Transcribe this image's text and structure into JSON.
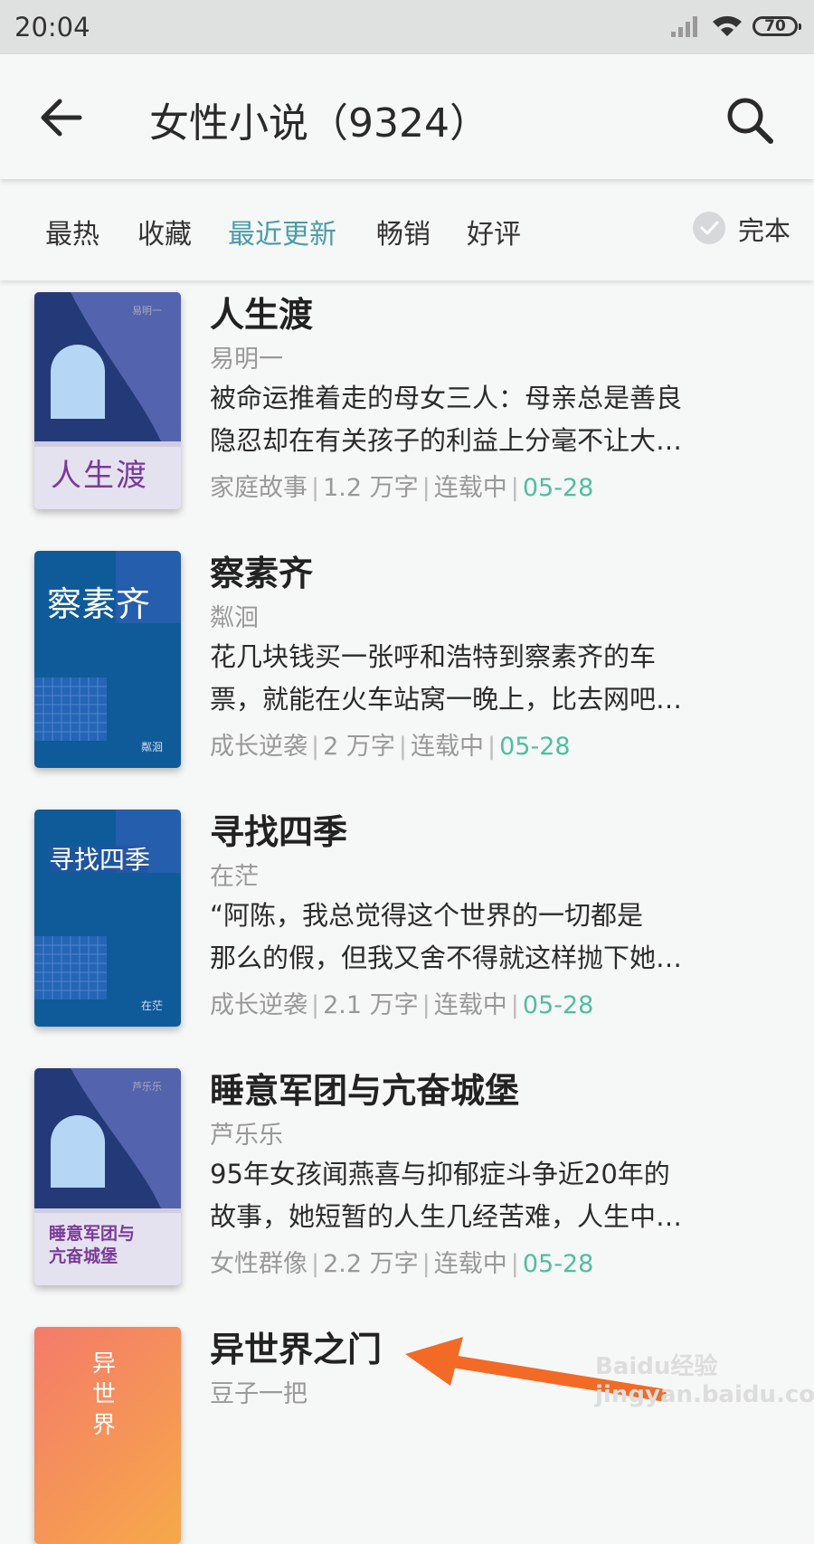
{
  "status": {
    "time": "20:04",
    "battery": "70"
  },
  "header": {
    "title": "女性小说（9324）"
  },
  "filters": {
    "tabs": [
      "最热",
      "收藏",
      "最近更新",
      "畅销",
      "好评"
    ],
    "active": "最近更新",
    "complete_label": "完本"
  },
  "books": [
    {
      "title": "人生渡",
      "author": "易明一",
      "desc1": "被命运推着走的母女三人：母亲总是善良",
      "desc2": "隐忍却在有关孩子的利益上分毫不让大…",
      "tag": "家庭故事",
      "words": "1.2 万字",
      "state": "连载中",
      "date": "05-28",
      "cover_title": "人生渡",
      "cover_author": "易明一"
    },
    {
      "title": "察素齐",
      "author": "粼洄",
      "desc1": "花几块钱买一张呼和浩特到察素齐的车",
      "desc2": "票，就能在火车站窝一晚上，比去网吧…",
      "tag": "成长逆袭",
      "words": "2 万字",
      "state": "连载中",
      "date": "05-28",
      "cover_title": "察素齐",
      "cover_author": "粼洄"
    },
    {
      "title": "寻找四季",
      "author": "在茫",
      "desc1": "“阿陈，我总觉得这个世界的一切都是",
      "desc2": "那么的假，但我又舍不得就这样抛下她…",
      "tag": "成长逆袭",
      "words": "2.1 万字",
      "state": "连载中",
      "date": "05-28",
      "cover_title": "寻找四季",
      "cover_author": "在茫"
    },
    {
      "title": "睡意军团与亢奋城堡",
      "author": "芦乐乐",
      "desc1": "95年女孩闻燕喜与抑郁症斗争近20年的",
      "desc2": "故事，她短暂的人生几经苦难，人生中…",
      "tag": "女性群像",
      "words": "2.2 万字",
      "state": "连载中",
      "date": "05-28",
      "cover_title1": "睡意军团与",
      "cover_title2": "亢奋城堡",
      "cover_author": "芦乐乐"
    },
    {
      "title": "异世界之门",
      "author": "豆子一把",
      "cover_title": "异世界"
    }
  ],
  "watermark": "Baidu经验 jingyan.baidu.com",
  "colors": {
    "accent": "#4a9ca8",
    "date": "#4dbf9f",
    "arrow": "#f26a25"
  }
}
